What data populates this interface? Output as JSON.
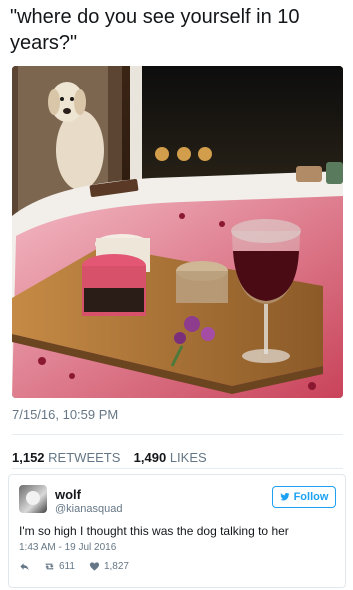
{
  "tweet": {
    "text": "\"where do you see yourself in 10 years?\"",
    "timestamp": "7/15/16, 10:59 PM",
    "retweets_count": "1,152",
    "retweets_label": "RETWEETS",
    "likes_count": "1,490",
    "likes_label": "LIKES"
  },
  "photo": {
    "alt_icon": "photo-dog-bathtub-wine"
  },
  "reply": {
    "name": "wolf",
    "handle": "@kianasquad",
    "follow_label": "Follow",
    "text": "I'm so high I thought this was the dog talking to her",
    "time": "1:43 AM - 19 Jul 2016",
    "retweets": "611",
    "likes": "1,827"
  },
  "colors": {
    "accent": "#1da1f2",
    "muted": "#657786",
    "text": "#14171a"
  }
}
